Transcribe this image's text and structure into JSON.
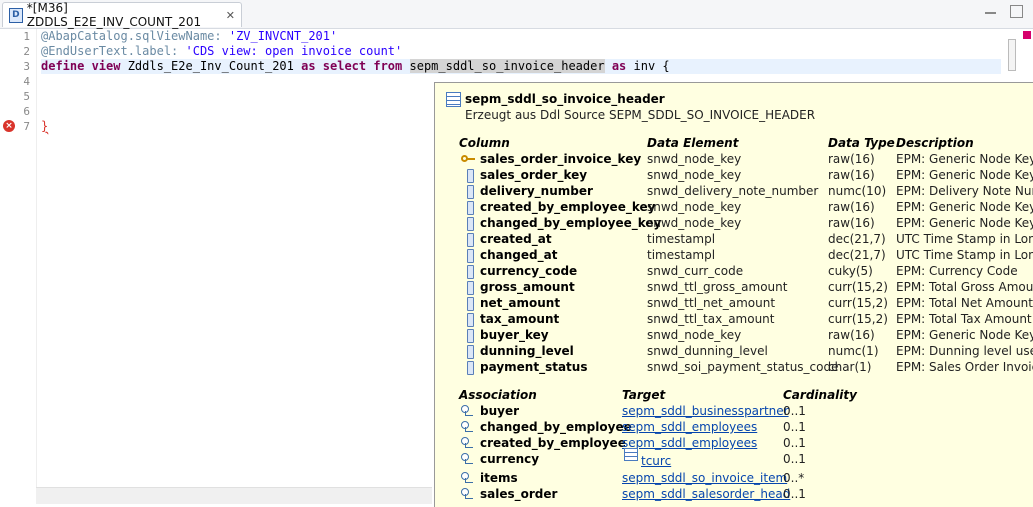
{
  "tab": {
    "title": "*[M36] ZDDLS_E2E_INV_COUNT_201",
    "close": "✕"
  },
  "editor": {
    "line_numbers": [
      "1",
      "2",
      "3",
      "4",
      "5",
      "6",
      "7"
    ],
    "line1": {
      "anno": "@AbapCatalog.sqlViewName: ",
      "str": "'ZV_INVCNT_201'"
    },
    "line2": {
      "anno": "@EndUserText.label: ",
      "str": "'CDS view: open invoice count'"
    },
    "line3": {
      "kw1": "define view",
      "t1": " Zddls_E2e_Inv_Count_201 ",
      "kw2": "as select from",
      "hl": "sepm_sddl_so_invoice_header",
      "kw3": "as",
      "t2": " inv {"
    },
    "line7": {
      "text": "}"
    },
    "error_icon": "×"
  },
  "popup": {
    "title": "sepm_sddl_so_invoice_header",
    "subtitle": "Erzeugt aus Ddl Source SEPM_SDDL_SO_INVOICE_HEADER",
    "columns_header": {
      "column": "Column",
      "data_element": "Data Element",
      "data_type": "Data Type",
      "description": "Description"
    },
    "columns": [
      {
        "name": "sales_order_invoice_key",
        "element": "snwd_node_key",
        "type": "raw(16)",
        "desc": "EPM: Generic Node Key",
        "icon": "key-icon"
      },
      {
        "name": "sales_order_key",
        "element": "snwd_node_key",
        "type": "raw(16)",
        "desc": "EPM: Generic Node Key",
        "icon": "column-icon"
      },
      {
        "name": "delivery_number",
        "element": "snwd_delivery_note_number",
        "type": "numc(10)",
        "desc": "EPM: Delivery Note Numb",
        "icon": "column-icon"
      },
      {
        "name": "created_by_employee_key",
        "element": "snwd_node_key",
        "type": "raw(16)",
        "desc": "EPM: Generic Node Key",
        "icon": "column-icon"
      },
      {
        "name": "changed_by_employee_key",
        "element": "snwd_node_key",
        "type": "raw(16)",
        "desc": "EPM: Generic Node Key",
        "icon": "column-icon"
      },
      {
        "name": "created_at",
        "element": "timestampl",
        "type": "dec(21,7)",
        "desc": "UTC Time Stamp in Long F",
        "icon": "column-icon"
      },
      {
        "name": "changed_at",
        "element": "timestampl",
        "type": "dec(21,7)",
        "desc": "UTC Time Stamp in Long F",
        "icon": "column-icon"
      },
      {
        "name": "currency_code",
        "element": "snwd_curr_code",
        "type": "cuky(5)",
        "desc": "EPM: Currency Code",
        "icon": "column-icon"
      },
      {
        "name": "gross_amount",
        "element": "snwd_ttl_gross_amount",
        "type": "curr(15,2)",
        "desc": "EPM: Total Gross Amount",
        "icon": "column-icon"
      },
      {
        "name": "net_amount",
        "element": "snwd_ttl_net_amount",
        "type": "curr(15,2)",
        "desc": "EPM: Total Net Amount",
        "icon": "column-icon"
      },
      {
        "name": "tax_amount",
        "element": "snwd_ttl_tax_amount",
        "type": "curr(15,2)",
        "desc": "EPM: Total Tax Amount",
        "icon": "column-icon"
      },
      {
        "name": "buyer_key",
        "element": "snwd_node_key",
        "type": "raw(16)",
        "desc": "EPM: Generic Node Key",
        "icon": "column-icon"
      },
      {
        "name": "dunning_level",
        "element": "snwd_dunning_level",
        "type": "numc(1)",
        "desc": "EPM: Dunning level used i",
        "icon": "column-icon"
      },
      {
        "name": "payment_status",
        "element": "snwd_soi_payment_status_code",
        "type": "char(1)",
        "desc": "EPM: Sales Order Invoice F",
        "icon": "column-icon"
      }
    ],
    "assoc_header": {
      "association": "Association",
      "target": "Target",
      "cardinality": "Cardinality"
    },
    "associations": [
      {
        "name": "buyer",
        "target": "sepm_sddl_businesspartner",
        "card": "0..1",
        "table": false
      },
      {
        "name": "changed_by_employee",
        "target": "sepm_sddl_employees",
        "card": "0..1",
        "table": false
      },
      {
        "name": "created_by_employee",
        "target": "sepm_sddl_employees",
        "card": "0..1",
        "table": false
      },
      {
        "name": "currency",
        "target": "tcurc",
        "card": "0..1",
        "table": true
      },
      {
        "name": "items",
        "target": "sepm_sddl_so_invoice_item",
        "card": "0..*",
        "table": false
      },
      {
        "name": "sales_order",
        "target": "sepm_sddl_salesorder_head",
        "card": "0..1",
        "table": false
      }
    ]
  }
}
